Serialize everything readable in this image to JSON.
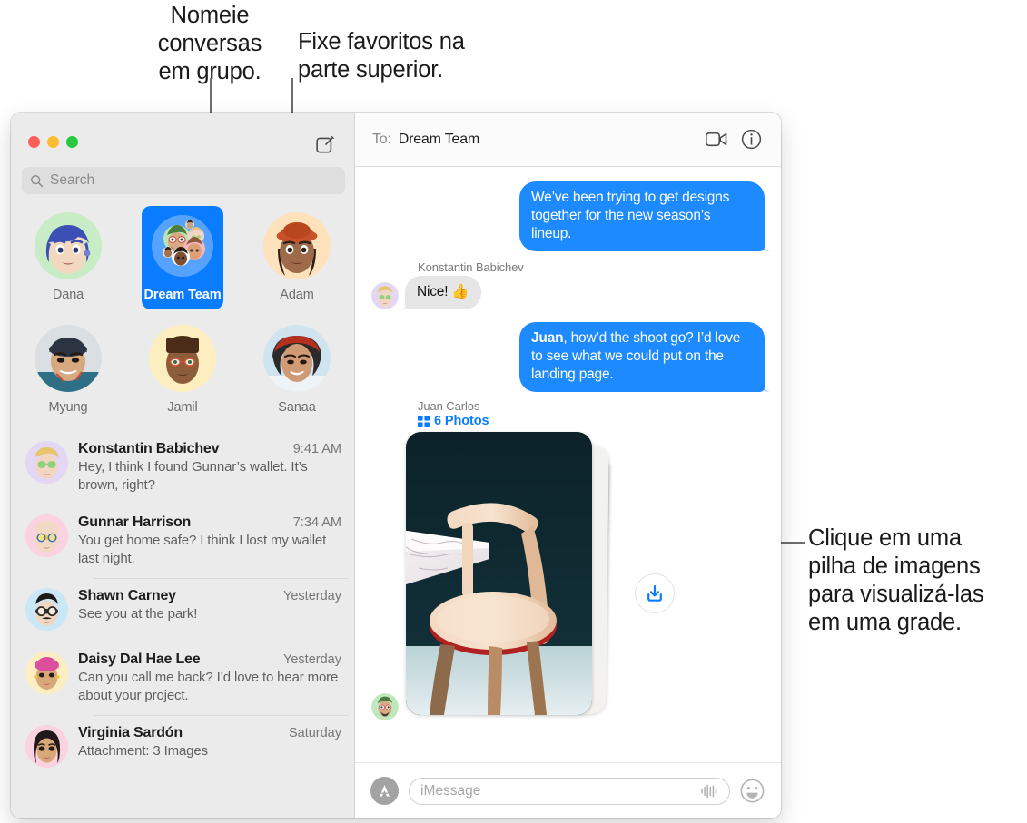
{
  "callouts": [
    {
      "id": "name-groups",
      "text": "Nomeie\nconversas\nem grupo."
    },
    {
      "id": "pin-favorites",
      "text": "Fixe favoritos na\nparte superior."
    },
    {
      "id": "image-stack",
      "text": "Clique em uma\npilha de imagens\npara visualizá-las\nem uma grade."
    }
  ],
  "window": {
    "traffic_lights": {
      "close": "close-button",
      "minimize": "minimize-button",
      "zoom": "zoom-button"
    },
    "compose_label": "compose-icon"
  },
  "search": {
    "placeholder": "Search",
    "value": ""
  },
  "pinned": [
    {
      "name": "Dana",
      "selected": false
    },
    {
      "name": "Dream Team",
      "selected": true
    },
    {
      "name": "Adam",
      "selected": false
    },
    {
      "name": "Myung",
      "selected": false
    },
    {
      "name": "Jamil",
      "selected": false
    },
    {
      "name": "Sanaa",
      "selected": false
    }
  ],
  "conversations": [
    {
      "name": "Konstantin Babichev",
      "time": "9:41 AM",
      "preview": "Hey, I think I found Gunnar’s wallet. It’s brown, right?"
    },
    {
      "name": "Gunnar Harrison",
      "time": "7:34 AM",
      "preview": "You get home safe? I think I lost my wallet last night."
    },
    {
      "name": "Shawn Carney",
      "time": "Yesterday",
      "preview": "See you at the park!"
    },
    {
      "name": "Daisy Dal Hae Lee",
      "time": "Yesterday",
      "preview": "Can you call me back? I’d love to hear more about your project."
    },
    {
      "name": "Virginia Sardón",
      "time": "Saturday",
      "preview": "Attachment: 3 Images"
    }
  ],
  "conversation": {
    "to_label": "To:",
    "to_value": "Dream Team",
    "facetime_icon": "video-camera-icon",
    "details_icon": "info-icon",
    "messages": [
      {
        "dir": "out",
        "text": "We’ve been trying to get designs together for the new season’s lineup."
      },
      {
        "dir": "in",
        "sender": "Konstantin Babichev",
        "text": "Nice!  👍"
      },
      {
        "dir": "out",
        "bold_prefix": "Juan",
        "text": ", how’d the shoot go? I’d love to see what we could put on the landing page."
      }
    ],
    "attachment": {
      "sender": "Juan Carlos",
      "count_label": "6 Photos",
      "grid_icon": "photo-grid-icon",
      "download_icon": "download-icon"
    }
  },
  "composer": {
    "apps_icon": "app-store-icon",
    "placeholder": "iMessage",
    "value": "",
    "audio_icon": "audio-waveform-icon",
    "emoji_icon": "smiley-icon"
  },
  "colors": {
    "accent_blue": "#0A7CFF",
    "bubble_blue": "#1D8AFF",
    "bubble_gray": "#E6E6E6",
    "sidebar_bg": "#EBEBEB",
    "traffic_red": "#FF5F57",
    "traffic_yellow": "#FEBC2E",
    "traffic_green": "#28C840"
  }
}
